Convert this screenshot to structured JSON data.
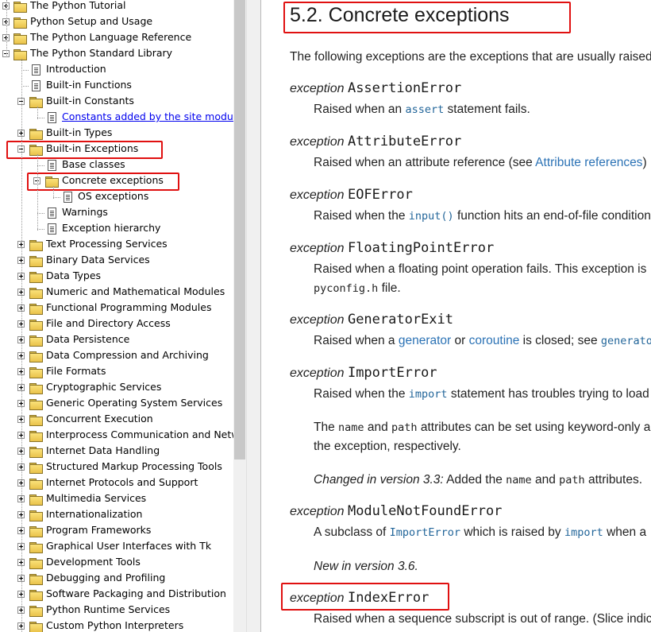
{
  "tree": {
    "items": [
      {
        "label": "The Python Tutorial",
        "level": 0,
        "type": "folder",
        "expander": "plus"
      },
      {
        "label": "Python Setup and Usage",
        "level": 0,
        "type": "folder",
        "expander": "plus"
      },
      {
        "label": "The Python Language Reference",
        "level": 0,
        "type": "folder",
        "expander": "plus"
      },
      {
        "label": "The Python Standard Library",
        "level": 0,
        "type": "folder-open",
        "expander": "minus"
      },
      {
        "label": "Introduction",
        "level": 1,
        "type": "doc",
        "expander": "none"
      },
      {
        "label": "Built-in Functions",
        "level": 1,
        "type": "doc",
        "expander": "none"
      },
      {
        "label": "Built-in Constants",
        "level": 1,
        "type": "folder-open",
        "expander": "minus"
      },
      {
        "label": "Constants added by the site module",
        "level": 2,
        "type": "doc",
        "expander": "none",
        "link": true
      },
      {
        "label": "Built-in Types",
        "level": 1,
        "type": "folder",
        "expander": "plus"
      },
      {
        "label": "Built-in Exceptions",
        "level": 1,
        "type": "folder-open",
        "expander": "minus",
        "highlight": true
      },
      {
        "label": "Base classes",
        "level": 2,
        "type": "doc",
        "expander": "none"
      },
      {
        "label": "Concrete exceptions",
        "level": 2,
        "type": "folder-open",
        "expander": "minus",
        "highlight": true
      },
      {
        "label": "OS exceptions",
        "level": 3,
        "type": "doc",
        "expander": "none"
      },
      {
        "label": "Warnings",
        "level": 2,
        "type": "doc",
        "expander": "none"
      },
      {
        "label": "Exception hierarchy",
        "level": 2,
        "type": "doc",
        "expander": "none"
      },
      {
        "label": "Text Processing Services",
        "level": 1,
        "type": "folder",
        "expander": "plus"
      },
      {
        "label": "Binary Data Services",
        "level": 1,
        "type": "folder",
        "expander": "plus"
      },
      {
        "label": "Data Types",
        "level": 1,
        "type": "folder",
        "expander": "plus"
      },
      {
        "label": "Numeric and Mathematical Modules",
        "level": 1,
        "type": "folder",
        "expander": "plus"
      },
      {
        "label": "Functional Programming Modules",
        "level": 1,
        "type": "folder",
        "expander": "plus"
      },
      {
        "label": "File and Directory Access",
        "level": 1,
        "type": "folder",
        "expander": "plus"
      },
      {
        "label": "Data Persistence",
        "level": 1,
        "type": "folder",
        "expander": "plus"
      },
      {
        "label": "Data Compression and Archiving",
        "level": 1,
        "type": "folder",
        "expander": "plus"
      },
      {
        "label": "File Formats",
        "level": 1,
        "type": "folder",
        "expander": "plus"
      },
      {
        "label": "Cryptographic Services",
        "level": 1,
        "type": "folder",
        "expander": "plus"
      },
      {
        "label": "Generic Operating System Services",
        "level": 1,
        "type": "folder",
        "expander": "plus"
      },
      {
        "label": "Concurrent Execution",
        "level": 1,
        "type": "folder",
        "expander": "plus"
      },
      {
        "label": "Interprocess Communication and Netwo",
        "level": 1,
        "type": "folder",
        "expander": "plus"
      },
      {
        "label": "Internet Data Handling",
        "level": 1,
        "type": "folder",
        "expander": "plus"
      },
      {
        "label": "Structured Markup Processing Tools",
        "level": 1,
        "type": "folder",
        "expander": "plus"
      },
      {
        "label": "Internet Protocols and Support",
        "level": 1,
        "type": "folder",
        "expander": "plus"
      },
      {
        "label": "Multimedia Services",
        "level": 1,
        "type": "folder",
        "expander": "plus"
      },
      {
        "label": "Internationalization",
        "level": 1,
        "type": "folder",
        "expander": "plus"
      },
      {
        "label": "Program Frameworks",
        "level": 1,
        "type": "folder",
        "expander": "plus"
      },
      {
        "label": "Graphical User Interfaces with Tk",
        "level": 1,
        "type": "folder",
        "expander": "plus"
      },
      {
        "label": "Development Tools",
        "level": 1,
        "type": "folder",
        "expander": "plus"
      },
      {
        "label": "Debugging and Profiling",
        "level": 1,
        "type": "folder",
        "expander": "plus"
      },
      {
        "label": "Software Packaging and Distribution",
        "level": 1,
        "type": "folder",
        "expander": "plus"
      },
      {
        "label": "Python Runtime Services",
        "level": 1,
        "type": "folder",
        "expander": "plus"
      },
      {
        "label": "Custom Python Interpreters",
        "level": 1,
        "type": "folder",
        "expander": "plus"
      }
    ]
  },
  "content": {
    "title": "5.2. Concrete exceptions",
    "intro": "The following exceptions are the exceptions that are usually raised",
    "keyword": "exception",
    "assertion": {
      "name": "AssertionError",
      "pre": "Raised when an ",
      "code": "assert",
      "post": " statement fails."
    },
    "attribute": {
      "name": "AttributeError",
      "pre": "Raised when an attribute reference (see ",
      "link": "Attribute references",
      "post": ")"
    },
    "eof": {
      "name": "EOFError",
      "pre": "Raised when the ",
      "code": "input()",
      "post": " function hits an end-of-file condition"
    },
    "floating": {
      "name": "FloatingPointError",
      "line1": "Raised when a floating point operation fails. This exception is",
      "code": "pyconfig.h",
      "post": " file."
    },
    "generator": {
      "name": "GeneratorExit",
      "pre": "Raised when a ",
      "link1": "generator",
      "mid1": " or ",
      "link2": "coroutine",
      "mid2": " is closed; see ",
      "code": "generato"
    },
    "import": {
      "name": "ImportError",
      "pre": "Raised when the ",
      "code": "import",
      "post": " statement has troubles trying to load",
      "p2_pre": "The ",
      "p2_code1": "name",
      "p2_mid": " and ",
      "p2_code2": "path",
      "p2_post": " attributes can be set using keyword-only a",
      "p2_line2": "the exception, respectively.",
      "changed_label": "Changed in version 3.3:",
      "changed_pre": " Added the ",
      "changed_code1": "name",
      "changed_mid": " and ",
      "changed_code2": "path",
      "changed_post": " attributes."
    },
    "modulenotfound": {
      "name": "ModuleNotFoundError",
      "pre": "A subclass of ",
      "code1": "ImportError",
      "mid": " which is raised by ",
      "code2": "import",
      "post": " when a",
      "new": "New in version 3.6."
    },
    "index": {
      "name": "IndexError",
      "text": "Raised when a sequence subscript is out of range. (Slice indic"
    }
  }
}
